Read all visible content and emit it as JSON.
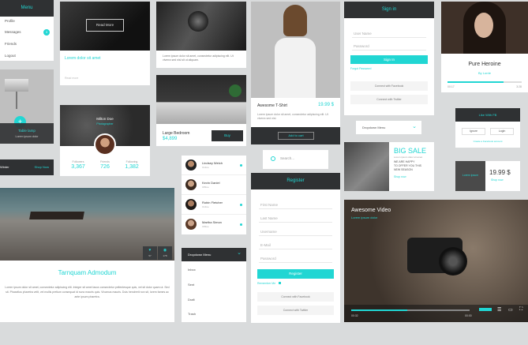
{
  "menu": {
    "title": "Menu",
    "items": [
      "Profile",
      "Messages",
      "Friends",
      "Logout"
    ],
    "badge": "3"
  },
  "read_card": {
    "button": "Read More",
    "title": "Lorem dolor sit amet",
    "link": "Read more"
  },
  "camera_card": {
    "text": "Lorem ipsum dolor sit amet, consectetur adipiscing elit. Ut viverra sed nisl sit ut aliquam."
  },
  "tshirt": {
    "name": "Awesome T-Shirt",
    "price": "19.99 $",
    "text": "Lorem ipsum dolor sit amet, consectetur adipiscing elit. Ut viverra sed nisl.",
    "button": "Add to cart"
  },
  "signin": {
    "title": "Sign in",
    "name_placeholder": "User Name",
    "password_placeholder": "Password",
    "button": "Sign In",
    "forgot": "Forgot Password",
    "facebook": "Connect with Facebook",
    "twitter": "Connect with Twitter"
  },
  "pure_heroine": {
    "title": "Pure Heroine",
    "subtitle": "By Lorde",
    "time_start": "00:17",
    "time_end": "3:28",
    "progress": 0.75
  },
  "lamp": {
    "title": "Table lamp",
    "subtitle": "Lorem ipsum dolor"
  },
  "profile": {
    "name": "Milton Doe",
    "role": "Photographer",
    "stats": [
      {
        "label": "Followers",
        "value": "3,367"
      },
      {
        "label": "Friends",
        "value": "726"
      },
      {
        "label": "Following",
        "value": "1,382"
      }
    ]
  },
  "bedroom": {
    "name": "Large Bedroom",
    "price": "$4,899",
    "button": "Buy"
  },
  "dropdown_small": {
    "label": "Dropdown Menu"
  },
  "search": {
    "placeholder": "Search..."
  },
  "sale": {
    "title": "BIG SALE",
    "subtitle": "Lorem ipsum dolor sit amet",
    "text": "WE ARE HAPPY\nTO OFFER YOU THIS\nNEW SEASON",
    "link": "Shop now"
  },
  "facebook_card": {
    "title": "Like With FB",
    "ignore": "Ignore",
    "login": "Login",
    "link": "Create a Facebook account"
  },
  "price_card": {
    "label": "Lorem ipsum",
    "price": "19.99 $",
    "action": "Shop now"
  },
  "shop_strip": {
    "label": "Winter",
    "action": "Shop Now"
  },
  "contacts": [
    {
      "name": "Lindsey Welch",
      "status": "Online",
      "dot": true
    },
    {
      "name": "Kevin Daniel",
      "status": "Offline",
      "dot": false
    },
    {
      "name": "Robin Fletcher",
      "status": "Online",
      "dot": true
    },
    {
      "name": "Martha Simon",
      "status": "Offline",
      "dot": true
    }
  ],
  "register": {
    "title": "Register",
    "fields": [
      "First Name",
      "Last Name",
      "Username",
      "E-Mail",
      "Password"
    ],
    "button": "Register",
    "remember": "Remember Me",
    "facebook": "Connect with Facebook",
    "twitter": "Connect with Twitter"
  },
  "dock": {
    "title": "Tarnquam Admodum",
    "text": "Lorem ipsum dolor sit amet, consectetur adipiscing elit. Integer sit amet lacus consectetur pellentesque quis, vel sit dolor quam ut. Sed sit. Phasellus pharetra velit, vel mollis pretium consequat id nunc mauris quis. Vivamus mauris. Duis hendrerit non sit, lorem fames ac ante ipsum pharetra.",
    "likes": "57",
    "views": "178"
  },
  "dropdown_menu": {
    "label": "Dropdown Menu",
    "items": [
      "Inbox",
      "Sent",
      "Draft",
      "Trash"
    ]
  },
  "video": {
    "title": "Awesome Video",
    "subtitle": "Lorem ipsum dolor",
    "time_start": "00:32",
    "time_end": "00:00",
    "progress": 0.47,
    "colors": {
      "accent": "#21d6d3",
      "dark": "#2f3133"
    }
  }
}
